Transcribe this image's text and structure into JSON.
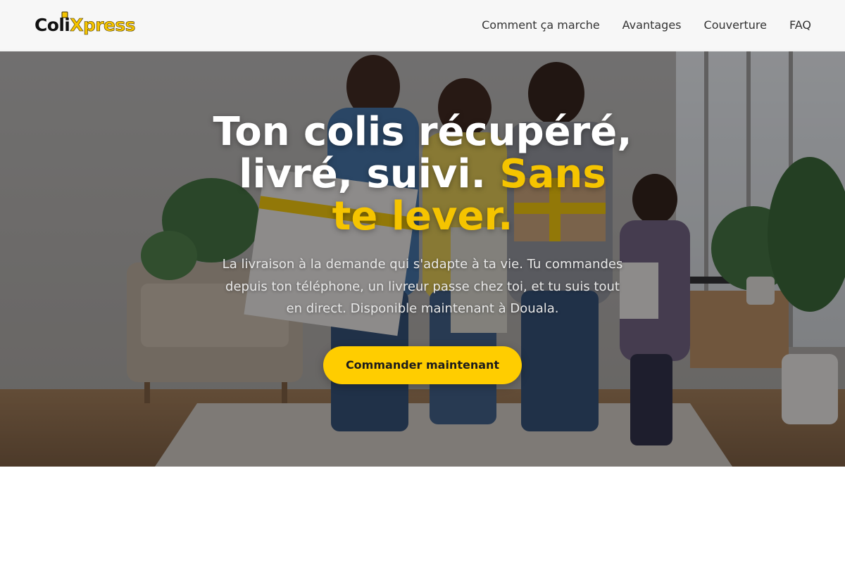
{
  "brand": {
    "logo_part1": "Coli",
    "logo_part2": "Xpress",
    "accent_color": "#f5c400",
    "cta_color": "#ffcd00"
  },
  "nav": {
    "items": [
      {
        "label": "Comment ça marche"
      },
      {
        "label": "Avantages"
      },
      {
        "label": "Couverture"
      },
      {
        "label": "FAQ"
      }
    ]
  },
  "hero": {
    "title_main": "Ton colis récupéré, livré, suivi. ",
    "title_accent": "Sans te lever.",
    "subtitle": "La livraison à la demande qui s'adapte à ta vie. Tu commandes depuis ton téléphone, un livreur passe chez toi, et tu suis tout en direct. Disponible maintenant à Douala.",
    "cta_label": "Commander maintenant",
    "image_subject": "family-holding-delivery-packages-photo"
  }
}
